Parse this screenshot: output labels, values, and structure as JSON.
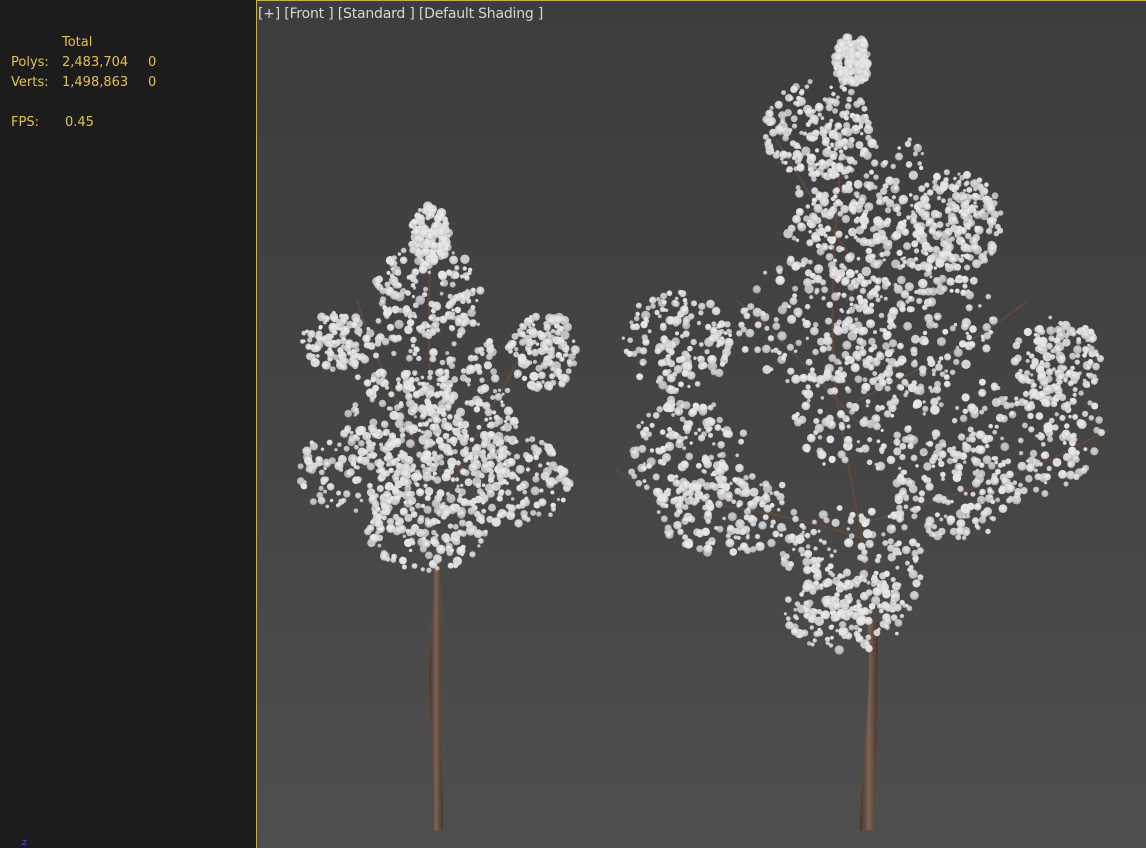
{
  "viewport": {
    "label": "[+] [Front ] [Standard ] [Default Shading ]",
    "accent_color": "#c8b042",
    "background_color": "#444444"
  },
  "stats": {
    "column_header": "Total",
    "polys_label": "Polys:",
    "polys_total": "2,483,704",
    "polys_selected": "0",
    "verts_label": "Verts:",
    "verts_total": "1,498,863",
    "verts_selected": "0",
    "fps_label": "FPS:",
    "fps_value": "0.45",
    "text_color": "#e2c24a"
  },
  "axis": {
    "label": "z"
  },
  "scene": {
    "objects": [
      "tree-small",
      "tree-large"
    ],
    "blossom_color": "#e6e6e6",
    "trunk_color": "#5e4a3e"
  }
}
